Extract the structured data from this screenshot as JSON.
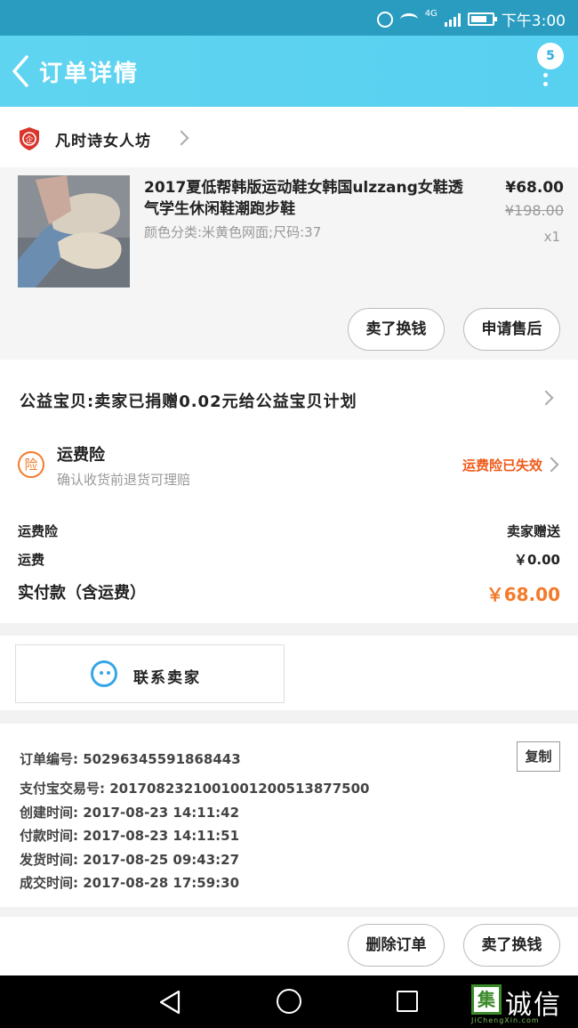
{
  "status_bar": {
    "network": "4G",
    "time": "下午3:00"
  },
  "header": {
    "title": "订单详情",
    "badge": "5"
  },
  "shop": {
    "name": "凡时诗女人坊"
  },
  "product": {
    "title": "2017夏低帮韩版运动鞋女韩国ulzzang女鞋透气学生休闲鞋潮跑步鞋",
    "spec": "颜色分类:米黄色网面;尺码:37",
    "price": "¥68.00",
    "original_price": "¥198.00",
    "quantity": "x1",
    "buttons": [
      "卖了换钱",
      "申请售后"
    ]
  },
  "charity": {
    "text": "公益宝贝:卖家已捐赠0.02元给公益宝贝计划"
  },
  "insurance": {
    "icon_label": "险",
    "title": "运费险",
    "subtitle": "确认收货前退货可理赔",
    "status": "运费险已失效"
  },
  "fees": [
    {
      "label": "运费险",
      "value": "卖家赠送"
    },
    {
      "label": "运费",
      "value": "￥0.00"
    },
    {
      "label": "实付款（含运费）",
      "value": "￥68.00"
    }
  ],
  "contact": {
    "label": "联系卖家"
  },
  "order_info": {
    "lines": [
      "订单编号: 50296345591868443",
      "支付宝交易号: 2017082321001001200513877500",
      "创建时间: 2017-08-23 14:11:42",
      "付款时间: 2017-08-23 14:11:51",
      "发货时间: 2017-08-25 09:43:27",
      "成交时间: 2017-08-28 17:59:30"
    ],
    "copy_label": "复制"
  },
  "actions": [
    "删除订单",
    "卖了换钱"
  ],
  "watermark": {
    "box": "集",
    "text": "诚信",
    "sub": "JiChengXin.com"
  },
  "colors": {
    "header": "#58d0ef",
    "accent_orange": "#f47a2a",
    "status_red": "#f05a19"
  }
}
